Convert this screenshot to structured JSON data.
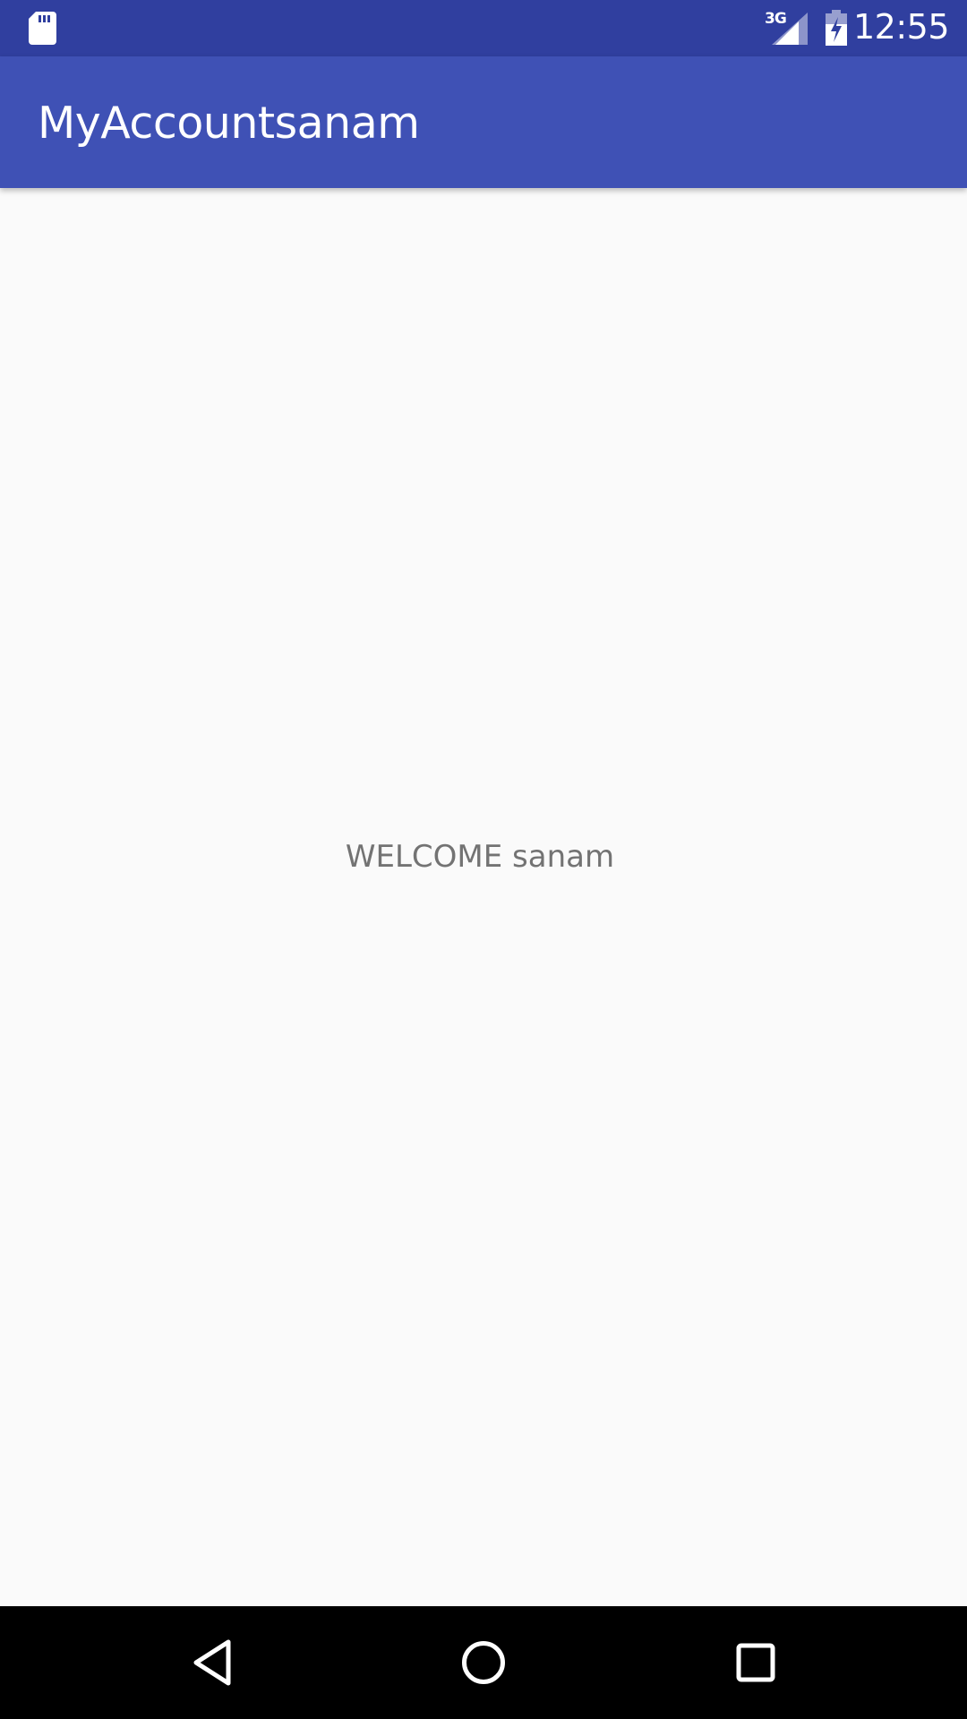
{
  "status_bar": {
    "network_type": "3G",
    "time": "12:55",
    "icons": [
      "sd-card-icon",
      "signal-icon",
      "battery-charging-icon"
    ]
  },
  "app_bar": {
    "title": "MyAccountsanam"
  },
  "main": {
    "welcome_text": "WELCOME sanam"
  },
  "nav_bar": {
    "icons": [
      "back-icon",
      "home-icon",
      "recents-icon"
    ]
  },
  "colors": {
    "status_bar": "#303F9F",
    "app_bar": "#3F51B5",
    "background": "#FAFAFA",
    "welcome_text": "#737373",
    "nav_bar": "#000000"
  }
}
